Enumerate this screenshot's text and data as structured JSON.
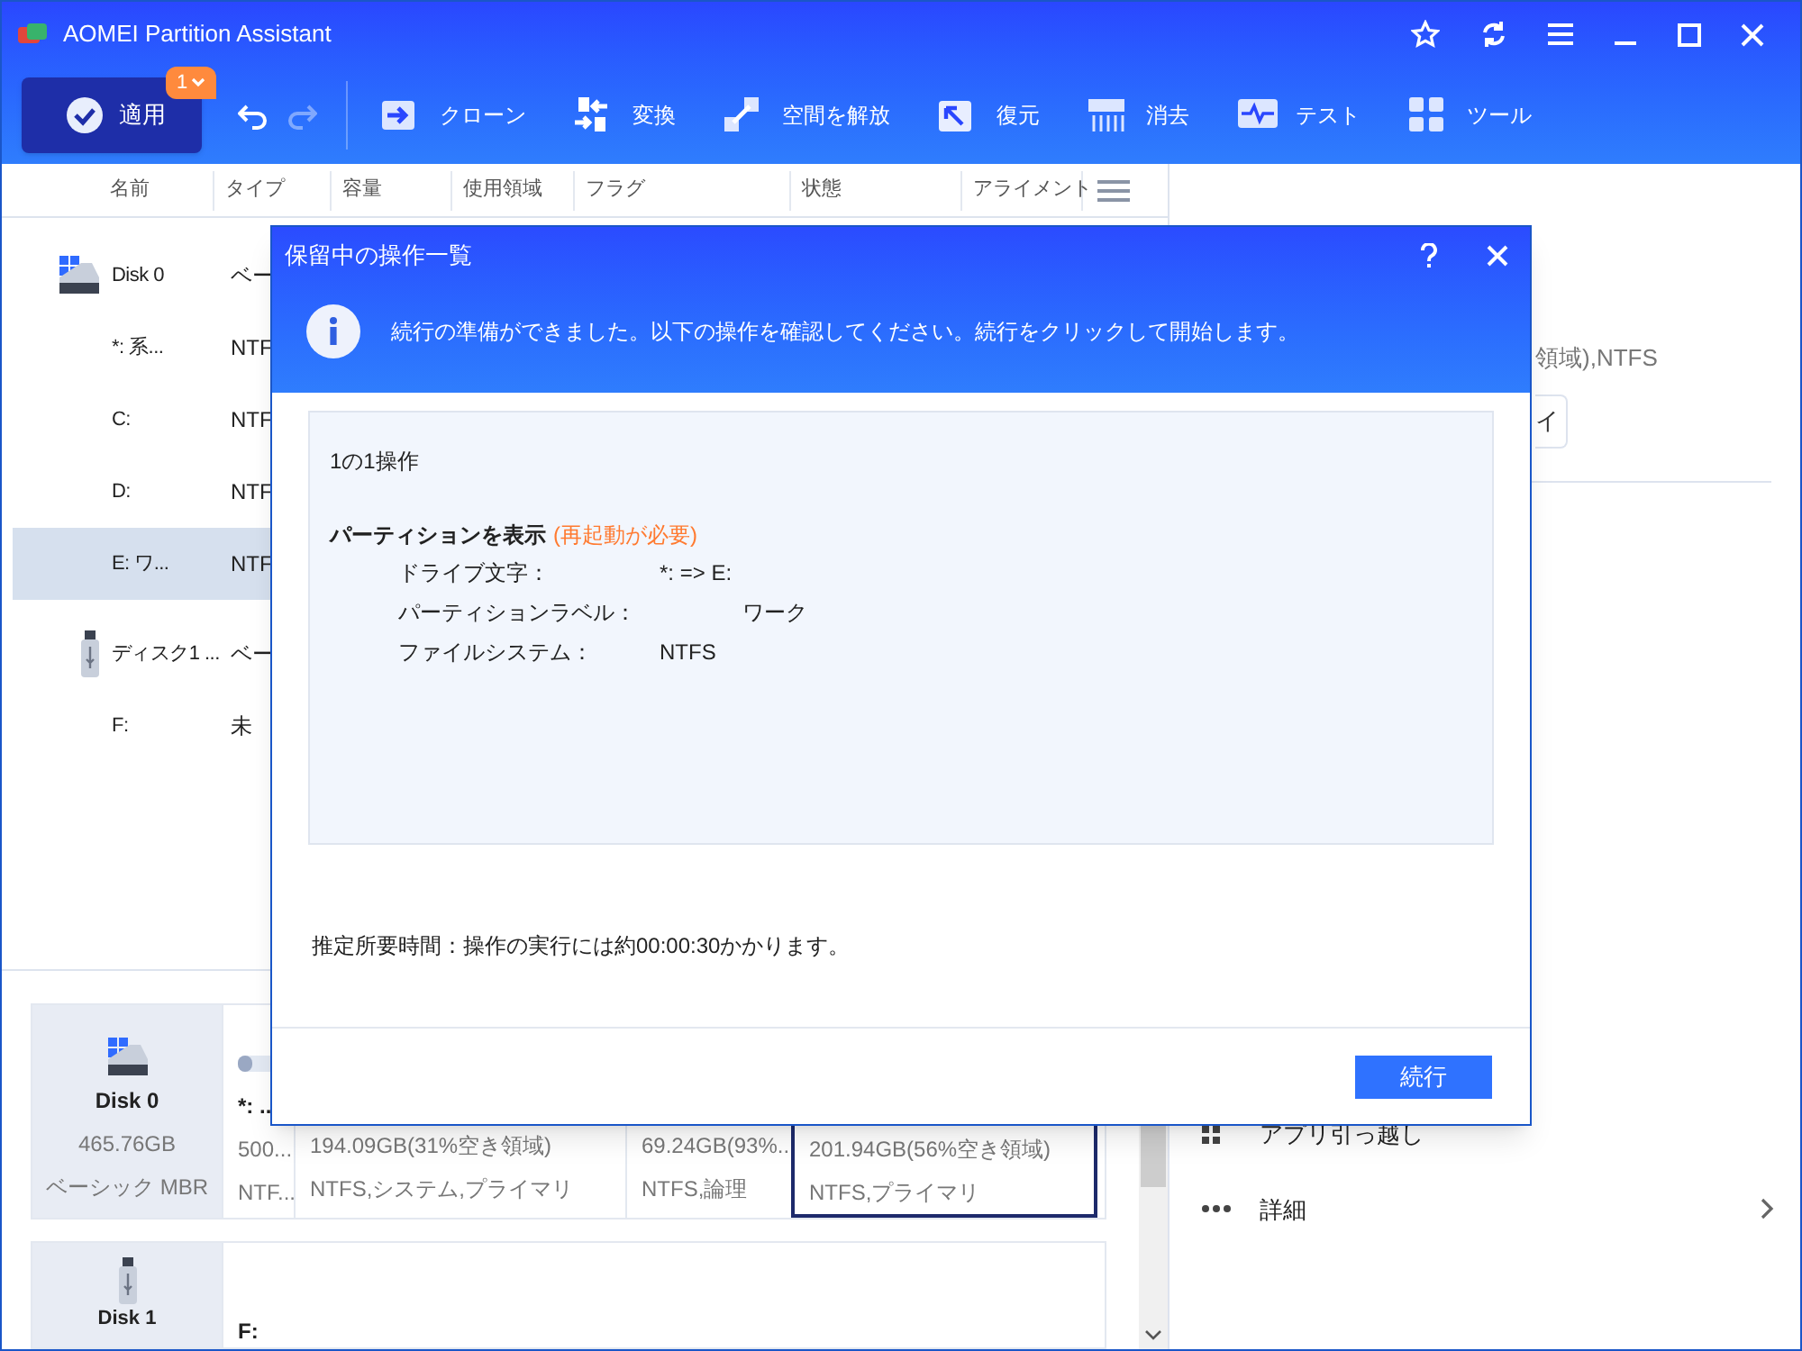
{
  "window": {
    "title": "AOMEI Partition Assistant"
  },
  "toolbar": {
    "apply": {
      "label": "適用",
      "badge": "1"
    },
    "undo": {
      "disabled": false
    },
    "redo": {
      "disabled": true
    },
    "tools": [
      {
        "kind": "clone",
        "label": "クローン"
      },
      {
        "kind": "convert",
        "label": "変換"
      },
      {
        "kind": "free-space",
        "label": "空間を解放"
      },
      {
        "kind": "restore",
        "label": "復元"
      },
      {
        "kind": "wipe",
        "label": "消去"
      },
      {
        "kind": "test",
        "label": "テスト"
      },
      {
        "kind": "tools",
        "label": "ツール"
      }
    ]
  },
  "table": {
    "columns": [
      "名前",
      "タイプ",
      "容量",
      "使用領域",
      "フラグ",
      "状態",
      "アライメント"
    ],
    "rows": [
      {
        "kind": "disk",
        "name": "Disk 0",
        "type": "ベー",
        "selected": false
      },
      {
        "kind": "partition",
        "name": "*: 系...",
        "type": "NTF",
        "selected": false
      },
      {
        "kind": "partition",
        "name": "C:",
        "type": "NTF",
        "selected": false
      },
      {
        "kind": "partition",
        "name": "D:",
        "type": "NTF",
        "selected": false
      },
      {
        "kind": "partition",
        "name": "E: ワ...",
        "type": "NTF",
        "selected": true
      },
      {
        "kind": "usb",
        "name": "ディスク1 ...",
        "type": "ベー",
        "selected": false
      },
      {
        "kind": "partition",
        "name": "F:",
        "type": "未",
        "selected": false
      }
    ]
  },
  "disk_map": [
    {
      "kind": "disk",
      "name": "Disk 0",
      "size": "465.76GB",
      "style": "ベーシック MBR",
      "partitions": [
        {
          "name": "*: ..",
          "size": "500....",
          "info": "NTF...",
          "level": 0.3,
          "selected": false
        },
        {
          "size": "194.09GB(31%空き領域)",
          "info": "NTFS,システム,プライマリ",
          "selected": false
        },
        {
          "size": "69.24GB(93%...",
          "info": "NTFS,論理",
          "selected": false
        },
        {
          "size": "201.94GB(56%空き領域)",
          "info": "NTFS,プライマリ",
          "selected": true
        }
      ]
    },
    {
      "kind": "usb",
      "name": "Disk 1",
      "partitions": [
        {
          "name": "F:",
          "selected": false
        }
      ]
    }
  ],
  "side_panel": {
    "summary": "領域),NTFS",
    "button": "イ",
    "actions": [
      {
        "kind": "apps",
        "label": "アプリ引っ越し"
      },
      {
        "kind": "more",
        "label": "詳細"
      }
    ]
  },
  "dialog": {
    "title": "保留中の操作一覧",
    "info": "続行の準備ができました。以下の操作を確認してください。続行をクリックして開始します。",
    "count": "1の1操作",
    "operation": {
      "title": "パーティションを表示",
      "note": "(再起動が必要)",
      "details": [
        {
          "label": "ドライブ文字：",
          "value": "*: => E:",
          "indent": false
        },
        {
          "label": "パーティションラベル：",
          "value": "ワーク",
          "indent": true
        },
        {
          "label": "ファイルシステム：",
          "value": "NTFS",
          "indent": false
        }
      ]
    },
    "estimate": "推定所要時間：操作の実行には約00:00:30かかります。",
    "button": "続行"
  }
}
